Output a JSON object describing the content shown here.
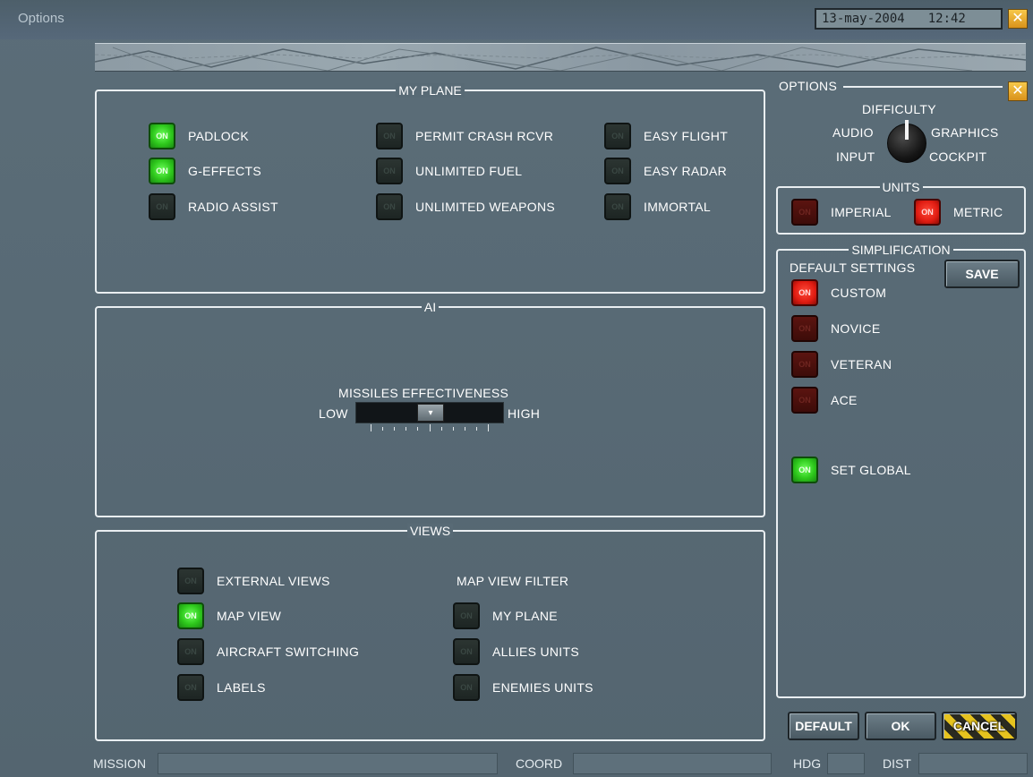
{
  "window": {
    "title": "Options",
    "date": "13-may-2004",
    "time": "12:42",
    "close_icon": "close-icon"
  },
  "my_plane": {
    "title": "MY PLANE",
    "items": [
      {
        "label": "PADLOCK",
        "state": "ON"
      },
      {
        "label": "G-EFFECTS",
        "state": "ON"
      },
      {
        "label": "RADIO ASSIST",
        "state": "ON"
      },
      {
        "label": "PERMIT CRASH RCVR",
        "state": "ON"
      },
      {
        "label": "UNLIMITED FUEL",
        "state": "ON"
      },
      {
        "label": "UNLIMITED WEAPONS",
        "state": "ON"
      },
      {
        "label": "EASY FLIGHT",
        "state": "ON"
      },
      {
        "label": "EASY RADAR",
        "state": "ON"
      },
      {
        "label": "IMMORTAL",
        "state": "ON"
      }
    ]
  },
  "ai": {
    "title": "AI",
    "slider": {
      "label": "MISSILES EFFECTIVENESS",
      "low": "LOW",
      "high": "HIGH",
      "level_fraction": 0.5
    }
  },
  "views": {
    "title": "VIEWS",
    "items": [
      {
        "label": "EXTERNAL VIEWS",
        "state": "ON"
      },
      {
        "label": "MAP VIEW",
        "state": "ON"
      },
      {
        "label": "AIRCRAFT SWITCHING",
        "state": "ON"
      },
      {
        "label": "LABELS",
        "state": "ON"
      }
    ],
    "filter_title": "MAP VIEW FILTER",
    "filter_items": [
      {
        "label": "MY PLANE",
        "state": "ON"
      },
      {
        "label": "ALLIES UNITS",
        "state": "ON"
      },
      {
        "label": "ENEMIES UNITS",
        "state": "ON"
      }
    ]
  },
  "options_panel": {
    "title": "OPTIONS",
    "knob_labels": {
      "top": "DIFFICULTY",
      "audio": "AUDIO",
      "graphics": "GRAPHICS",
      "input": "INPUT",
      "cockpit": "COCKPIT"
    }
  },
  "units": {
    "title": "UNITS",
    "imperial": {
      "label": "IMPERIAL",
      "state": "ON"
    },
    "metric": {
      "label": "METRIC",
      "state": "ON"
    }
  },
  "simplification": {
    "title": "SIMPLIFICATION",
    "default_settings": "DEFAULT SETTINGS",
    "save_label": "SAVE",
    "items": [
      {
        "label": "CUSTOM",
        "state": "ON"
      },
      {
        "label": "NOVICE",
        "state": "ON"
      },
      {
        "label": "VETERAN",
        "state": "ON"
      },
      {
        "label": "ACE",
        "state": "ON"
      }
    ],
    "set_global": {
      "label": "SET GLOBAL",
      "state": "ON"
    }
  },
  "buttons": {
    "default": "DEFAULT",
    "ok": "OK",
    "cancel": "CANCEL"
  },
  "footer": {
    "mission": "MISSION",
    "coord": "COORD",
    "hdg": "HDG",
    "dist": "DIST"
  },
  "colors": {
    "panel_bg": "#586a75",
    "led_green": "#2ec81c",
    "led_red": "#e01c12",
    "led_off": "#1d2523",
    "accent": "#e6c31e"
  }
}
